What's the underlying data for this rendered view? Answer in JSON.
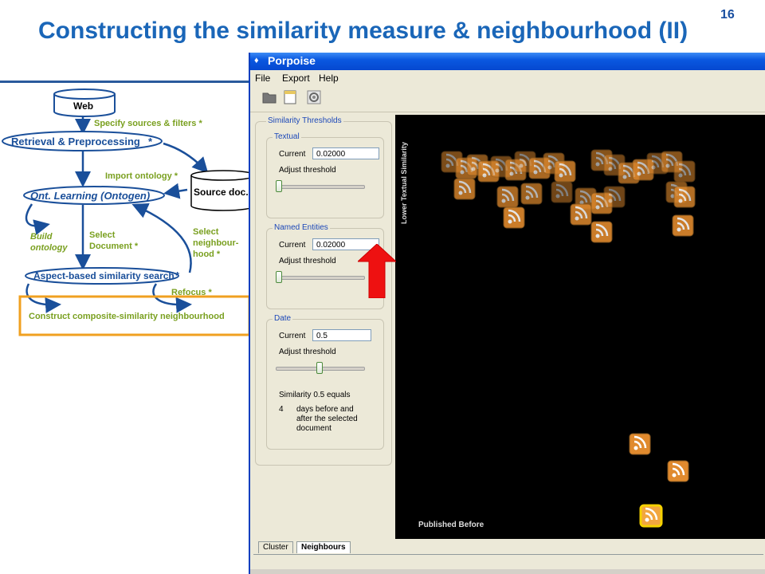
{
  "slide": {
    "title": "Constructing the similarity measure & neighbourhood (II)",
    "number": "16"
  },
  "diagram": {
    "web": "Web",
    "retrieval": "Retrieval & Preprocessing",
    "retrieval_star": "*",
    "specify": "Specify sources & filters *",
    "import": "Import ontology *",
    "source_doc": "Source doc.",
    "ont_learning": "Ont. Learning (Ontogen)",
    "build": "Build",
    "ontology": "ontology",
    "select_doc_1": "Select",
    "select_doc_2": "Document *",
    "select_nb_1": "Select",
    "select_nb_2": "neighbour-",
    "select_nb_3": "hood *",
    "aspect": "Aspect-based similarity search",
    "aspect_star": "*",
    "refocus": "Refocus *",
    "construct": "Construct composite-similarity neighbourhood"
  },
  "app": {
    "title": "Porpoise",
    "menu": [
      "File",
      "Export",
      "Help"
    ],
    "panel": {
      "title": "Similarity Thresholds",
      "textual": {
        "label": "Textual",
        "current_label": "Current",
        "current_value": "0.02000",
        "adjust": "Adjust threshold",
        "level": 0.0
      },
      "named": {
        "label": "Named Entities",
        "current_label": "Current",
        "current_value": "0.02000",
        "adjust": "Adjust threshold",
        "level": 0.0
      },
      "date": {
        "label": "Date",
        "current_label": "Current",
        "current_value": "0.5",
        "adjust": "Adjust threshold",
        "level": 0.5,
        "sim_text": "Similarity 0.5 equals",
        "days_num": "4",
        "days_line1": "days before and",
        "days_line2": "after the selected",
        "days_line3": "document"
      }
    },
    "canvas": {
      "y_label": "Lower Textual Similarity",
      "x_label": "Published Before"
    },
    "tabs": [
      "Cluster",
      "Neighbours"
    ],
    "active_tab": "Neighbours"
  },
  "colors": {
    "title": "#1a66b8",
    "diagram_blue": "#1a4f9a",
    "diagram_green": "#7aa020",
    "highlight_box": "#f0a020",
    "arrow": "#ee1111",
    "rss": "#e08a2e"
  }
}
